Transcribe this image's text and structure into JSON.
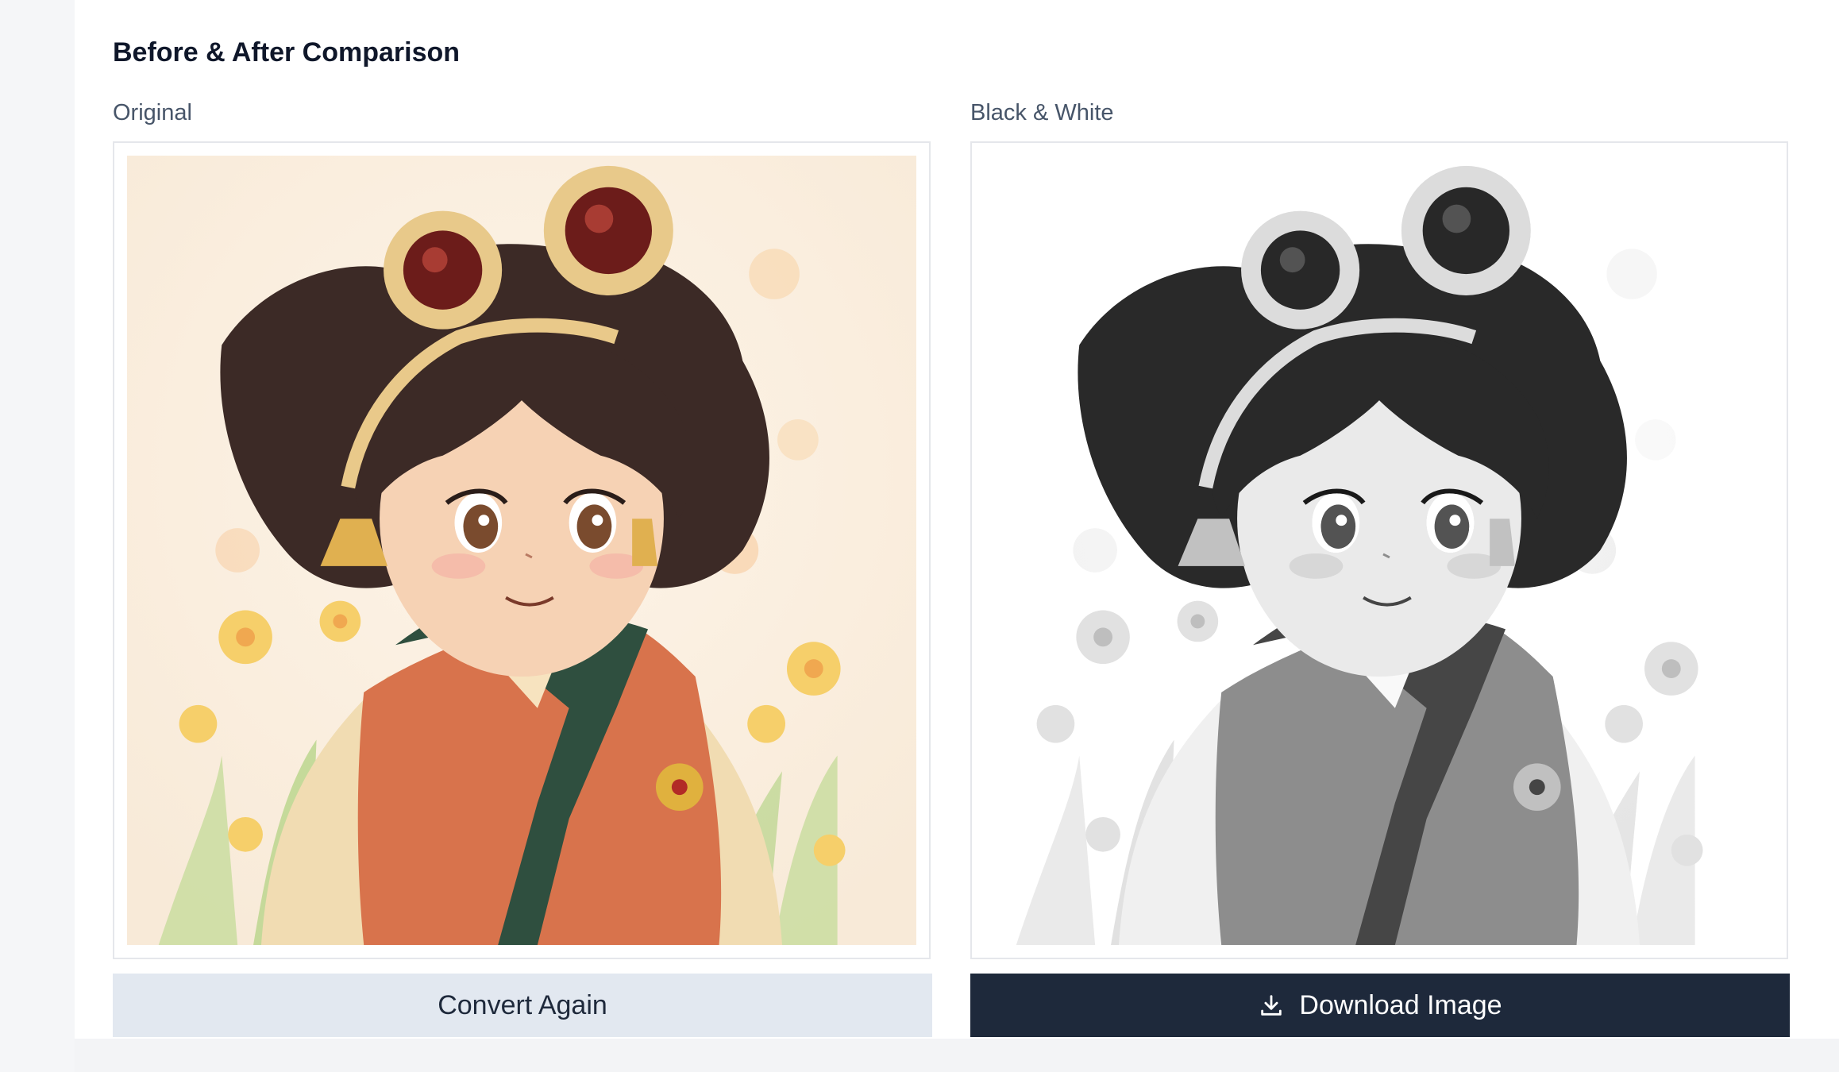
{
  "section": {
    "title": "Before & After Comparison"
  },
  "columns": {
    "original_label": "Original",
    "bw_label": "Black & White"
  },
  "buttons": {
    "convert_label": "Convert Again",
    "download_label": "Download Image",
    "download_icon": "download-icon"
  },
  "colors": {
    "primary_dark": "#1e293b",
    "secondary_light": "#e2e8f0",
    "label_gray": "#475569"
  }
}
